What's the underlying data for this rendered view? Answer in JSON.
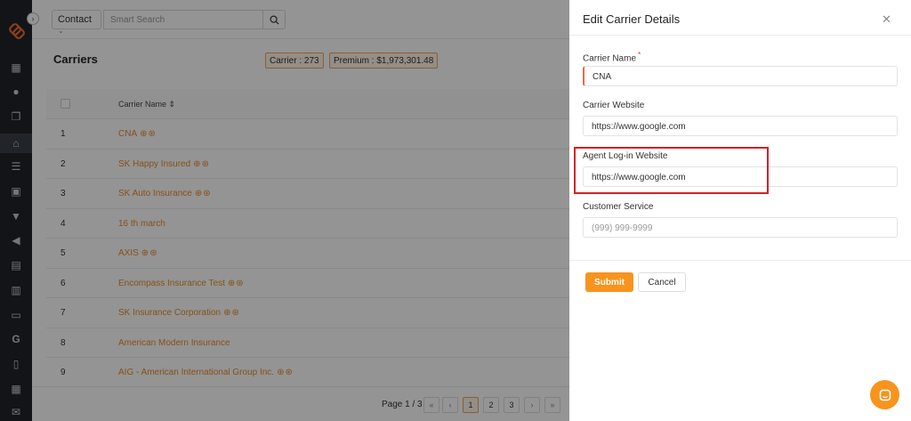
{
  "topbar": {
    "contact_select": "Contact",
    "search_placeholder": "Smart Search"
  },
  "page": {
    "title": "Carriers",
    "carrier_count": "Carrier : 273",
    "premium_total": "Premium : $1,973,301.48"
  },
  "table": {
    "header_name": "Carrier Name ⇕",
    "rows": [
      {
        "num": "1",
        "name": "CNA"
      },
      {
        "num": "2",
        "name": "SK Happy Insured"
      },
      {
        "num": "3",
        "name": "SK Auto Insurance"
      },
      {
        "num": "4",
        "name": "16 th march"
      },
      {
        "num": "5",
        "name": "AXIS"
      },
      {
        "num": "6",
        "name": "Encompass Insurance Test"
      },
      {
        "num": "7",
        "name": "SK Insurance Corporation"
      },
      {
        "num": "8",
        "name": "American Modern Insurance"
      },
      {
        "num": "9",
        "name": "AIG - American International Group Inc."
      }
    ]
  },
  "pager": {
    "text": "Page 1 / 3",
    "first": "«",
    "prev": "‹",
    "pages": [
      "1",
      "2",
      "3"
    ],
    "next": "›",
    "last": "»"
  },
  "drawer": {
    "title": "Edit Carrier Details",
    "carrier_name_label": "Carrier Name",
    "required_mark": "*",
    "carrier_name_value": "CNA",
    "carrier_website_label": "Carrier Website",
    "carrier_website_value": "https://www.google.com",
    "agent_login_label": "Agent Log-in Website",
    "agent_login_value": "https://www.google.com",
    "customer_service_label": "Customer Service",
    "customer_service_placeholder": "(999) 999-9999",
    "submit_label": "Submit",
    "cancel_label": "Cancel"
  },
  "colors": {
    "accent": "#f7941d",
    "link": "#e88a2c",
    "highlight": "#d81f26",
    "sidebar": "#1f2329"
  },
  "icons": {
    "sidebar": [
      "dashboard-icon",
      "users-icon",
      "copy-icon",
      "bank-icon",
      "list-icon",
      "contact-card-icon",
      "funnel-icon",
      "megaphone-icon",
      "document-icon",
      "chart-icon",
      "folder-icon",
      "google-icon",
      "clipboard-icon",
      "calendar-icon",
      "mail-icon"
    ]
  }
}
